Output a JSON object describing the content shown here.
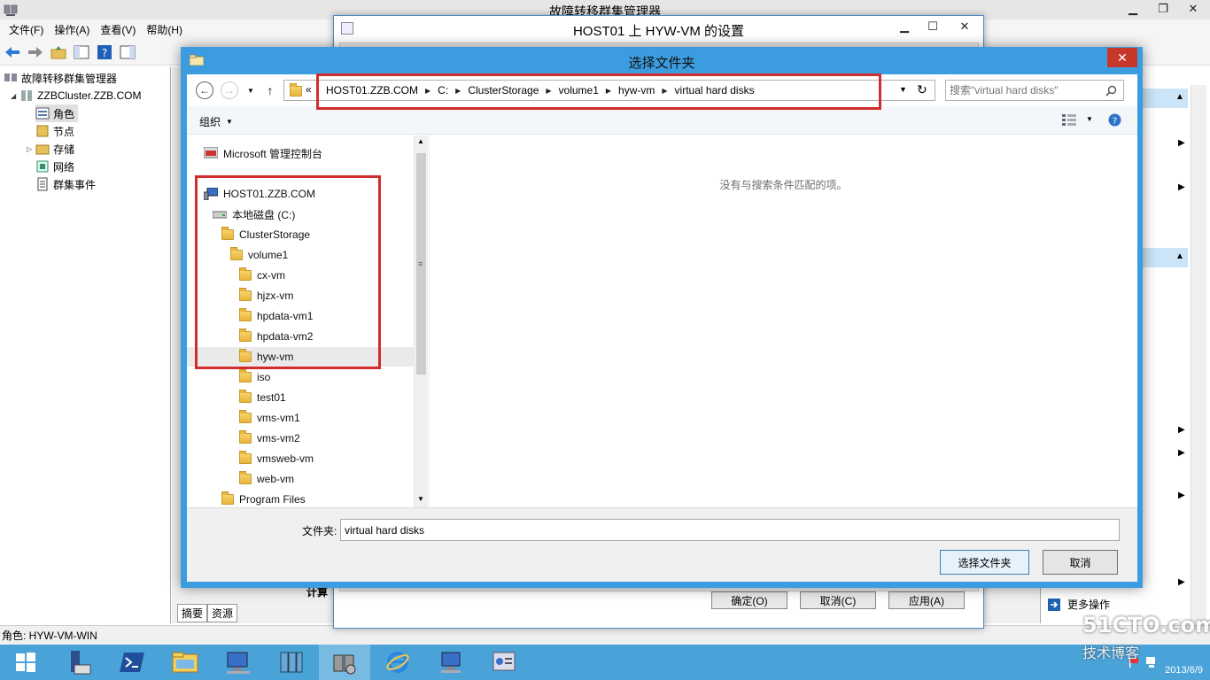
{
  "main": {
    "title": "故障转移群集管理器",
    "menu": [
      "文件(F)",
      "操作(A)",
      "查看(V)",
      "帮助(H)"
    ],
    "tree": {
      "root": "故障转移群集管理器",
      "cluster": "ZZBCluster.ZZB.COM",
      "items": [
        "角色",
        "节点",
        "存储",
        "网络",
        "群集事件"
      ]
    },
    "bottom_tabs": [
      "摘要",
      "资源"
    ],
    "status": "角色:  HYW-VM-WIN",
    "more_actions": "更多操作",
    "partial_label": "计算"
  },
  "settings": {
    "title": "HOST01 上 HYW-VM 的设置",
    "ok": "确定(O)",
    "cancel": "取消(C)",
    "apply": "应用(A)"
  },
  "dialog": {
    "title": "选择文件夹",
    "breadcrumb": [
      "HOST01.ZZB.COM",
      "C:",
      "ClusterStorage",
      "volume1",
      "hyw-vm",
      "virtual hard disks"
    ],
    "breadcrumb_prefix": "«",
    "search_placeholder": "搜索\"virtual hard disks\"",
    "organize": "组织",
    "nav_tree": {
      "mmc": "Microsoft 管理控制台",
      "host": "HOST01.ZZB.COM",
      "drive": "本地磁盘 (C:)",
      "cluster_storage": "ClusterStorage",
      "volume": "volume1",
      "vm_folders": [
        "cx-vm",
        "hjzx-vm",
        "hpdata-vm1",
        "hpdata-vm2",
        "hyw-vm",
        "iso",
        "test01",
        "vms-vm1",
        "vms-vm2",
        "vmsweb-vm",
        "web-vm"
      ],
      "program_files": "Program Files",
      "selected": "hyw-vm"
    },
    "empty_message": "没有与搜索条件匹配的项。",
    "folder_label": "文件夹:",
    "folder_value": "virtual hard disks",
    "select_button": "选择文件夹",
    "cancel_button": "取消"
  },
  "taskbar": {
    "date": "2013/6/9",
    "watermark": "51CTO.com",
    "watermark_sub": "技术博客"
  },
  "colors": {
    "accent": "#3c9ce0",
    "close_red": "#c7372a",
    "highlight_red": "#d22d2d",
    "taskbar": "#4aa3d8"
  }
}
